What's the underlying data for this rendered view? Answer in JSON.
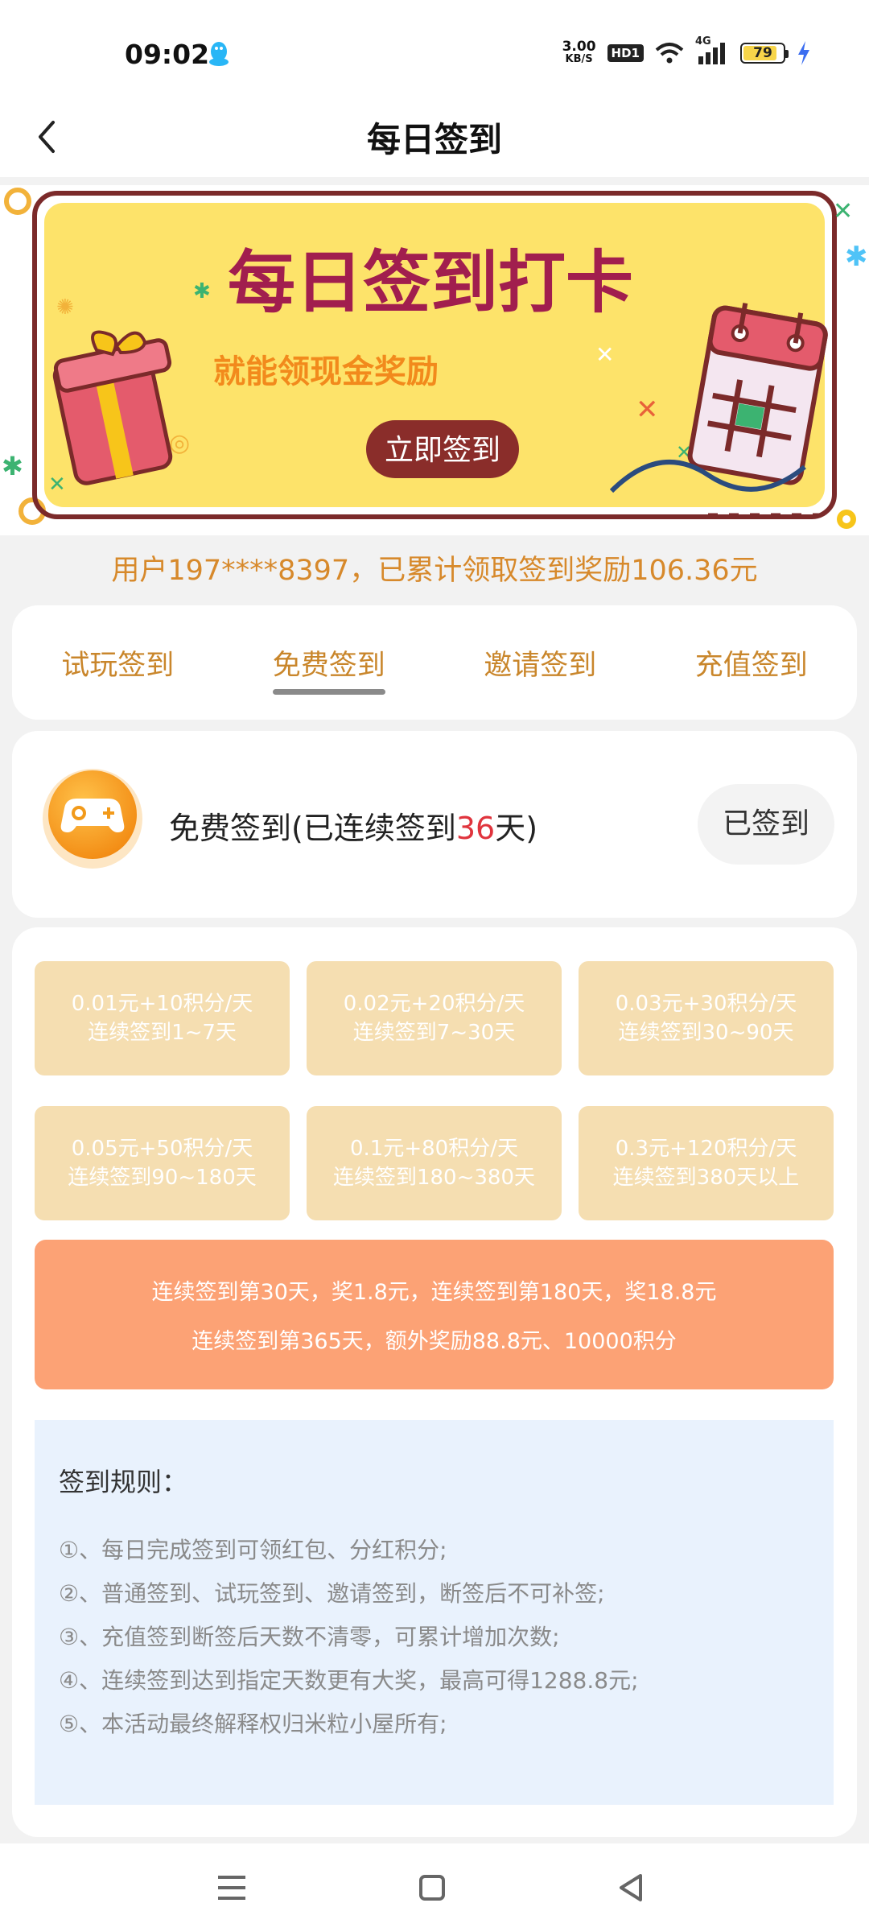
{
  "status_bar": {
    "time": "09:02",
    "net_speed_value": "3.00",
    "net_speed_unit": "KB/S",
    "hd_label": "HD1",
    "signal_label": "4G",
    "battery": "79"
  },
  "header": {
    "title": "每日签到"
  },
  "banner": {
    "headline": "每日签到打卡",
    "subline": "就能领现金奖励",
    "button_label": "立即签到"
  },
  "summary": "用户197****8397，已累计领取签到奖励106.36元",
  "tabs": [
    {
      "label": "试玩签到"
    },
    {
      "label": "免费签到"
    },
    {
      "label": "邀请签到"
    },
    {
      "label": "充值签到"
    }
  ],
  "status": {
    "text_prefix": "免费签到(已连续签到",
    "days": "36",
    "text_suffix": "天)",
    "button_label": "已签到"
  },
  "tiers": [
    {
      "reward": "0.01元+10积分/天",
      "range": "连续签到1~7天"
    },
    {
      "reward": "0.02元+20积分/天",
      "range": "连续签到7~30天"
    },
    {
      "reward": "0.03元+30积分/天",
      "range": "连续签到30~90天"
    },
    {
      "reward": "0.05元+50积分/天",
      "range": "连续签到90~180天"
    },
    {
      "reward": "0.1元+80积分/天",
      "range": "连续签到180~380天"
    },
    {
      "reward": "0.3元+120积分/天",
      "range": "连续签到380天以上"
    }
  ],
  "bonus": {
    "line1": "连续签到第30天，奖1.8元，连续签到第180天，奖18.8元",
    "line2": "连续签到第365天，额外奖励88.8元、10000积分"
  },
  "rules": {
    "title": "签到规则：",
    "items": [
      "①、每日完成签到可领红包、分红积分;",
      "②、普通签到、试玩签到、邀请签到，断签后不可补签;",
      "③、充值签到断签后天数不清零，可累计增加次数;",
      "④、连续签到达到指定天数更有大奖，最高可得1288.8元;",
      "⑤、本活动最终解释权归米粒小屋所有;"
    ]
  },
  "colors": {
    "accent": "#c9862b",
    "tier_bg": "#f5deb1",
    "bonus_bg": "#fca275",
    "rules_bg": "#e9f2fd",
    "banner_bg": "#fde36a"
  }
}
